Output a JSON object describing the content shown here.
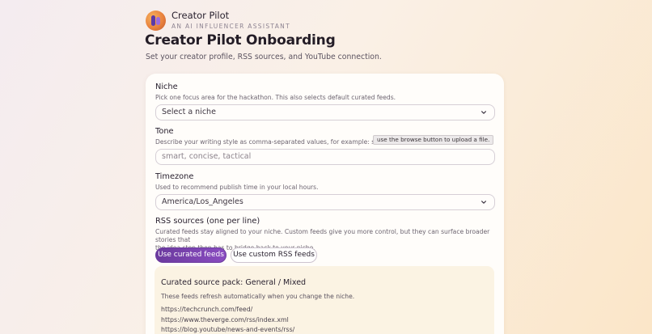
{
  "brand": {
    "name": "Creator Pilot",
    "tagline": "AN AI INFLUENCER ASSISTANT"
  },
  "page": {
    "title": "Creator Pilot Onboarding",
    "subtitle": "Set your creator profile, RSS sources, and YouTube connection."
  },
  "niche": {
    "label": "Niche",
    "help": "Pick one focus area for the hackathon. This also selects default curated feeds.",
    "selected": "Select a niche"
  },
  "tone": {
    "label": "Tone",
    "help": "Describe your writing style as comma-separated values, for example: smart, c",
    "placeholder": "smart, concise, tactical"
  },
  "tooltip": "use the browse button to upload a file.",
  "timezone": {
    "label": "Timezone",
    "help": "Used to recommend publish time in your local hours.",
    "selected": "America/Los_Angeles"
  },
  "rss": {
    "label": "RSS sources (one per line)",
    "help_line1": "Curated feeds stay aligned to your niche. Custom feeds give you more control, but they can surface broader stories that",
    "help_line2": "the idea step then has to bridge back to your niche.",
    "curated_button": "Use curated feeds",
    "custom_button": "Use custom RSS feeds"
  },
  "pack": {
    "title": "Curated source pack: General / Mixed",
    "description": "These feeds refresh automatically when you change the niche.",
    "feeds": [
      "https://techcrunch.com/feed/",
      "https://www.theverge.com/rss/index.xml",
      "https://blog.youtube/news-and-events/rss/"
    ]
  },
  "colors": {
    "accent": "#7b44b0",
    "card": "#fffdfa",
    "pack_bg": "#fbf3e3"
  }
}
